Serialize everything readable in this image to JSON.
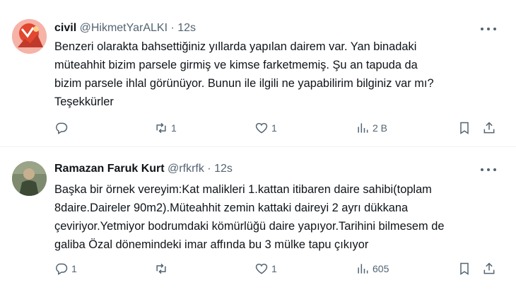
{
  "tweets": [
    {
      "name": "civil",
      "handle": "@HikmetYarALKI",
      "separator": "·",
      "time": "12s",
      "text_lines": [
        "Benzeri olarakta bahsettiğiniz yıllarda yapılan dairem var. Yan binadaki",
        "müteahhit bizim parsele girmiş ve kimse farketmemiş. Şu an tapuda da",
        "bizim parsele ihlal görünüyor. Bunun ile ilgili ne yapabilirim bilginiz var mı?",
        "Teşekkürler"
      ],
      "replies": "",
      "retweets": "1",
      "likes": "1",
      "views": "2 B"
    },
    {
      "name": "Ramazan Faruk Kurt",
      "handle": "@rfkrfk",
      "separator": "·",
      "time": "12s",
      "text_lines": [
        "Başka bir örnek vereyim:Kat malikleri 1.kattan itibaren daire sahibi(toplam",
        "8daire.Daireler 90m2).Müteahhit zemin kattaki daireyi 2 ayrı dükkana",
        "çeviriyor.Yetmiyor bodrumdaki kömürlüğü daire yapıyor.Tarihini bilmesem de",
        "galiba Özal dönemindeki imar affında bu 3 mülke tapu çıkıyor"
      ],
      "replies": "1",
      "retweets": "",
      "likes": "1",
      "views": "605"
    }
  ],
  "icons": {
    "reply": "reply-icon",
    "retweet": "retweet-icon",
    "like": "heart-icon",
    "views": "views-icon",
    "bookmark": "bookmark-icon",
    "share": "share-icon",
    "more": "more-icon"
  },
  "colors": {
    "text": "#0f1419",
    "secondary": "#536471",
    "divider": "#eff3f4"
  }
}
